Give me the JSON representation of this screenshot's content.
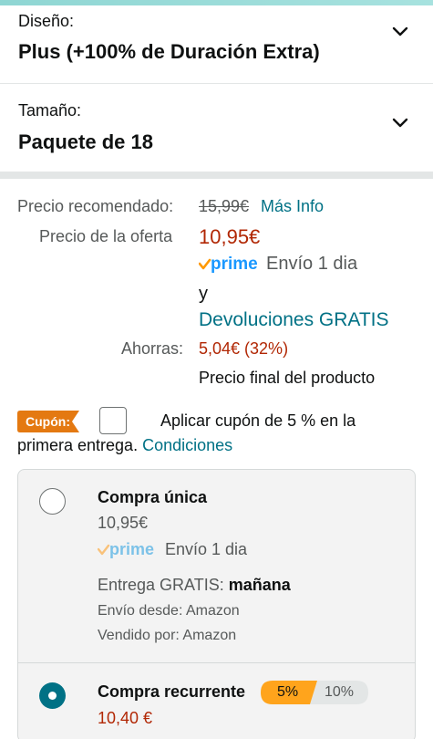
{
  "variants": {
    "design": {
      "label": "Diseño:",
      "value": "Plus (+100% de Duración Extra)"
    },
    "size": {
      "label": "Tamaño:",
      "value": "Paquete de 18"
    }
  },
  "pricing": {
    "recommended_label": "Precio recomendado:",
    "recommended_price": "15,99€",
    "more_info": "Más Info",
    "offer_label": "Precio de la oferta",
    "offer_price": "10,95€",
    "prime_badge": "prime",
    "shipping": "Envío 1 dia",
    "and": "y",
    "returns": "Devoluciones GRATIS",
    "savings_label": "Ahorras:",
    "savings_value": "5,04€ (32%)",
    "final_note": "Precio final del producto"
  },
  "coupon": {
    "badge": "Cupón:",
    "text_line1": "Aplicar cupón de 5 % en la",
    "text_line2": "primera entrega.",
    "conditions": "Condiciones"
  },
  "purchase_options": {
    "one_time": {
      "title": "Compra única",
      "price": "10,95€",
      "prime_badge": "prime",
      "shipping": "Envío 1 dia",
      "delivery_prefix": "Entrega GRATIS:",
      "delivery_day": "mañana",
      "ships_from": "Envío desde: Amazon",
      "sold_by": "Vendido por: Amazon",
      "selected": false
    },
    "recurring": {
      "title": "Compra recurrente",
      "discount_selected": "5%",
      "discount_other": "10%",
      "price": "10,40 €",
      "selected": true
    }
  },
  "colors": {
    "link": "#007185",
    "price": "#b12704",
    "coupon_badge": "#e47911",
    "prime_blue": "#1a98ff",
    "prime_check": "#f90",
    "selected_radio": "#007185",
    "pill_selected": "#ffa41c"
  }
}
